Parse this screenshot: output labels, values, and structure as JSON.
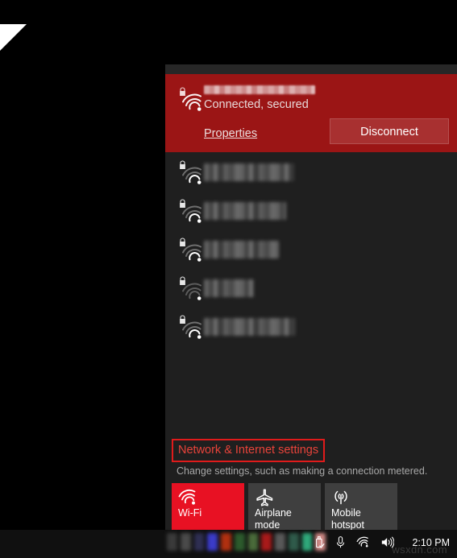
{
  "desktop": {
    "background_color": "#000000",
    "corner_shape": "white-triangle"
  },
  "flyout": {
    "accent_color": "#e81123",
    "panel_background": "#1f1f1f",
    "connected_panel_color": "#9b1515",
    "connected": {
      "ssid": "",
      "ssid_redacted": true,
      "status": "Connected, secured",
      "properties_label": "Properties",
      "disconnect_label": "Disconnect",
      "lock_icon": "lock-icon",
      "signal_icon": "wifi-signal-icon",
      "signal_bars": 3
    },
    "networks": [
      {
        "ssid": "",
        "ssid_redacted": true,
        "secured": true,
        "signal_bars": 3,
        "redact_width": 112
      },
      {
        "ssid": "",
        "ssid_redacted": true,
        "secured": true,
        "signal_bars": 3,
        "redact_width": 102
      },
      {
        "ssid": "",
        "ssid_redacted": true,
        "secured": true,
        "signal_bars": 3,
        "redact_width": 93
      },
      {
        "ssid": "",
        "ssid_redacted": true,
        "secured": true,
        "signal_bars": 1,
        "redact_width": 62
      },
      {
        "ssid": "",
        "ssid_redacted": true,
        "secured": true,
        "signal_bars": 3,
        "redact_width": 113
      }
    ],
    "footer": {
      "settings_link": "Network & Internet settings",
      "settings_link_color": "#e8433a",
      "highlight_box_color": "#e01b1b",
      "subtext": "Change settings, such as making a connection metered.",
      "tiles": [
        {
          "label": "Wi-Fi",
          "icon": "wifi-icon",
          "state": "on",
          "color": "#e81123"
        },
        {
          "label": "Airplane mode",
          "icon": "airplane-icon",
          "state": "off",
          "color": "#3f3f3f"
        },
        {
          "label": "Mobile hotspot",
          "icon": "hotspot-icon",
          "state": "off",
          "color": "#3f3f3f"
        }
      ]
    }
  },
  "taskbar": {
    "background_color": "#101010",
    "tray_icons": [
      "usb-icon",
      "microphone-icon",
      "wifi-icon",
      "volume-icon"
    ],
    "clock": "2:10 PM",
    "watermark": "wsxdn.com"
  }
}
